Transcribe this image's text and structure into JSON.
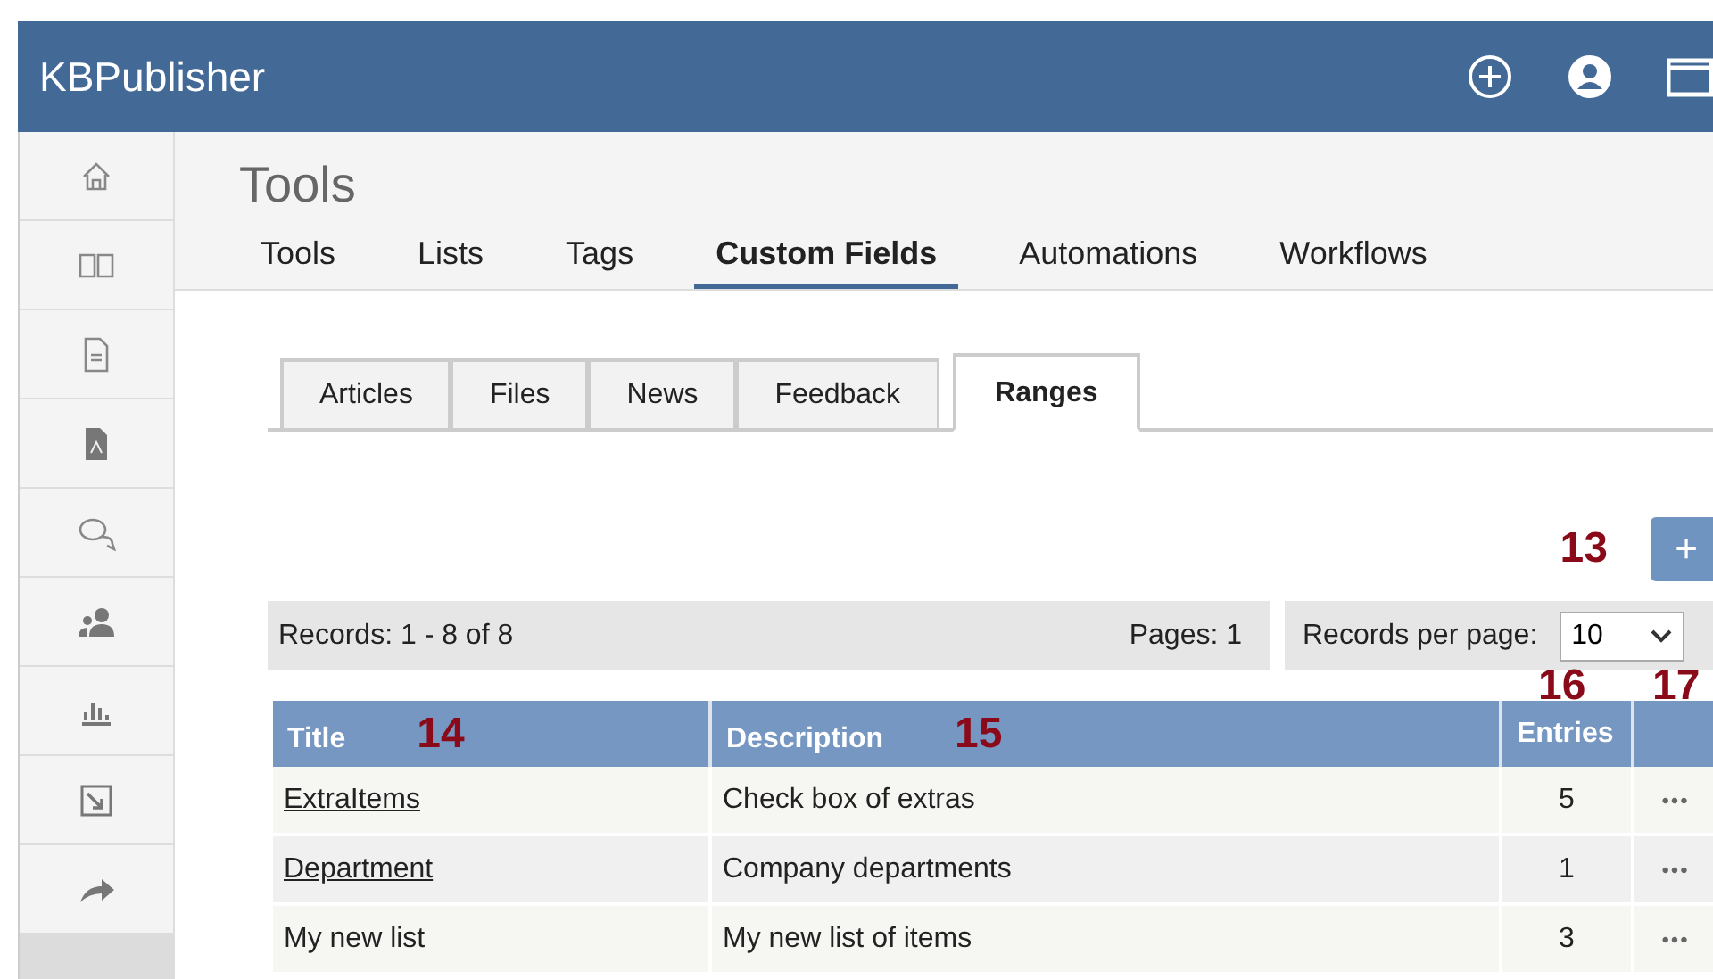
{
  "app": {
    "title": "KBPublisher"
  },
  "header_icons": [
    {
      "kind": "add"
    },
    {
      "kind": "user"
    },
    {
      "kind": "window"
    }
  ],
  "sidebar": {
    "items": [
      {
        "kind": "home",
        "selected": false
      },
      {
        "kind": "book",
        "selected": false
      },
      {
        "kind": "document",
        "selected": false
      },
      {
        "kind": "pdf",
        "selected": false
      },
      {
        "kind": "chat",
        "selected": false
      },
      {
        "kind": "users",
        "selected": false
      },
      {
        "kind": "chart",
        "selected": false
      },
      {
        "kind": "export",
        "selected": false
      },
      {
        "kind": "share",
        "selected": false
      },
      {
        "kind": "blank",
        "selected": true
      }
    ]
  },
  "page_title": "Tools",
  "nav_tabs": [
    {
      "label": "Tools",
      "selected": false
    },
    {
      "label": "Lists",
      "selected": false
    },
    {
      "label": "Tags",
      "selected": false
    },
    {
      "label": "Custom Fields",
      "selected": true
    },
    {
      "label": "Automations",
      "selected": false
    },
    {
      "label": "Workflows",
      "selected": false
    }
  ],
  "sub_tabs": [
    {
      "label": "Articles",
      "selected": false
    },
    {
      "label": "Files",
      "selected": false
    },
    {
      "label": "News",
      "selected": false
    },
    {
      "label": "Feedback",
      "selected": false
    },
    {
      "label": "Ranges",
      "selected": true
    }
  ],
  "add_button": {
    "label": "+",
    "callout": "13"
  },
  "records_bar": {
    "records": "Records: 1 - 8 of 8",
    "pages": "Pages: 1",
    "per_page_label": "Records per page:",
    "per_page_value": "10"
  },
  "table": {
    "columns": [
      {
        "label": "Title",
        "callout": "14",
        "kind": "title"
      },
      {
        "label": "Description",
        "callout": "15",
        "kind": "text"
      },
      {
        "label": "Entries",
        "callout": "16",
        "kind": "number"
      },
      {
        "callout": "17",
        "kind": "actions"
      }
    ],
    "rows": [
      {
        "title": "ExtraItems",
        "link": true,
        "description": "Check box of extras",
        "entries": "5",
        "actions": "•••"
      },
      {
        "title": "Department",
        "link": true,
        "description": "Company departments",
        "entries": "1",
        "actions": "•••"
      },
      {
        "title": "My new list",
        "link": false,
        "description": "My new list of items",
        "entries": "3",
        "actions": "•••"
      }
    ]
  }
}
